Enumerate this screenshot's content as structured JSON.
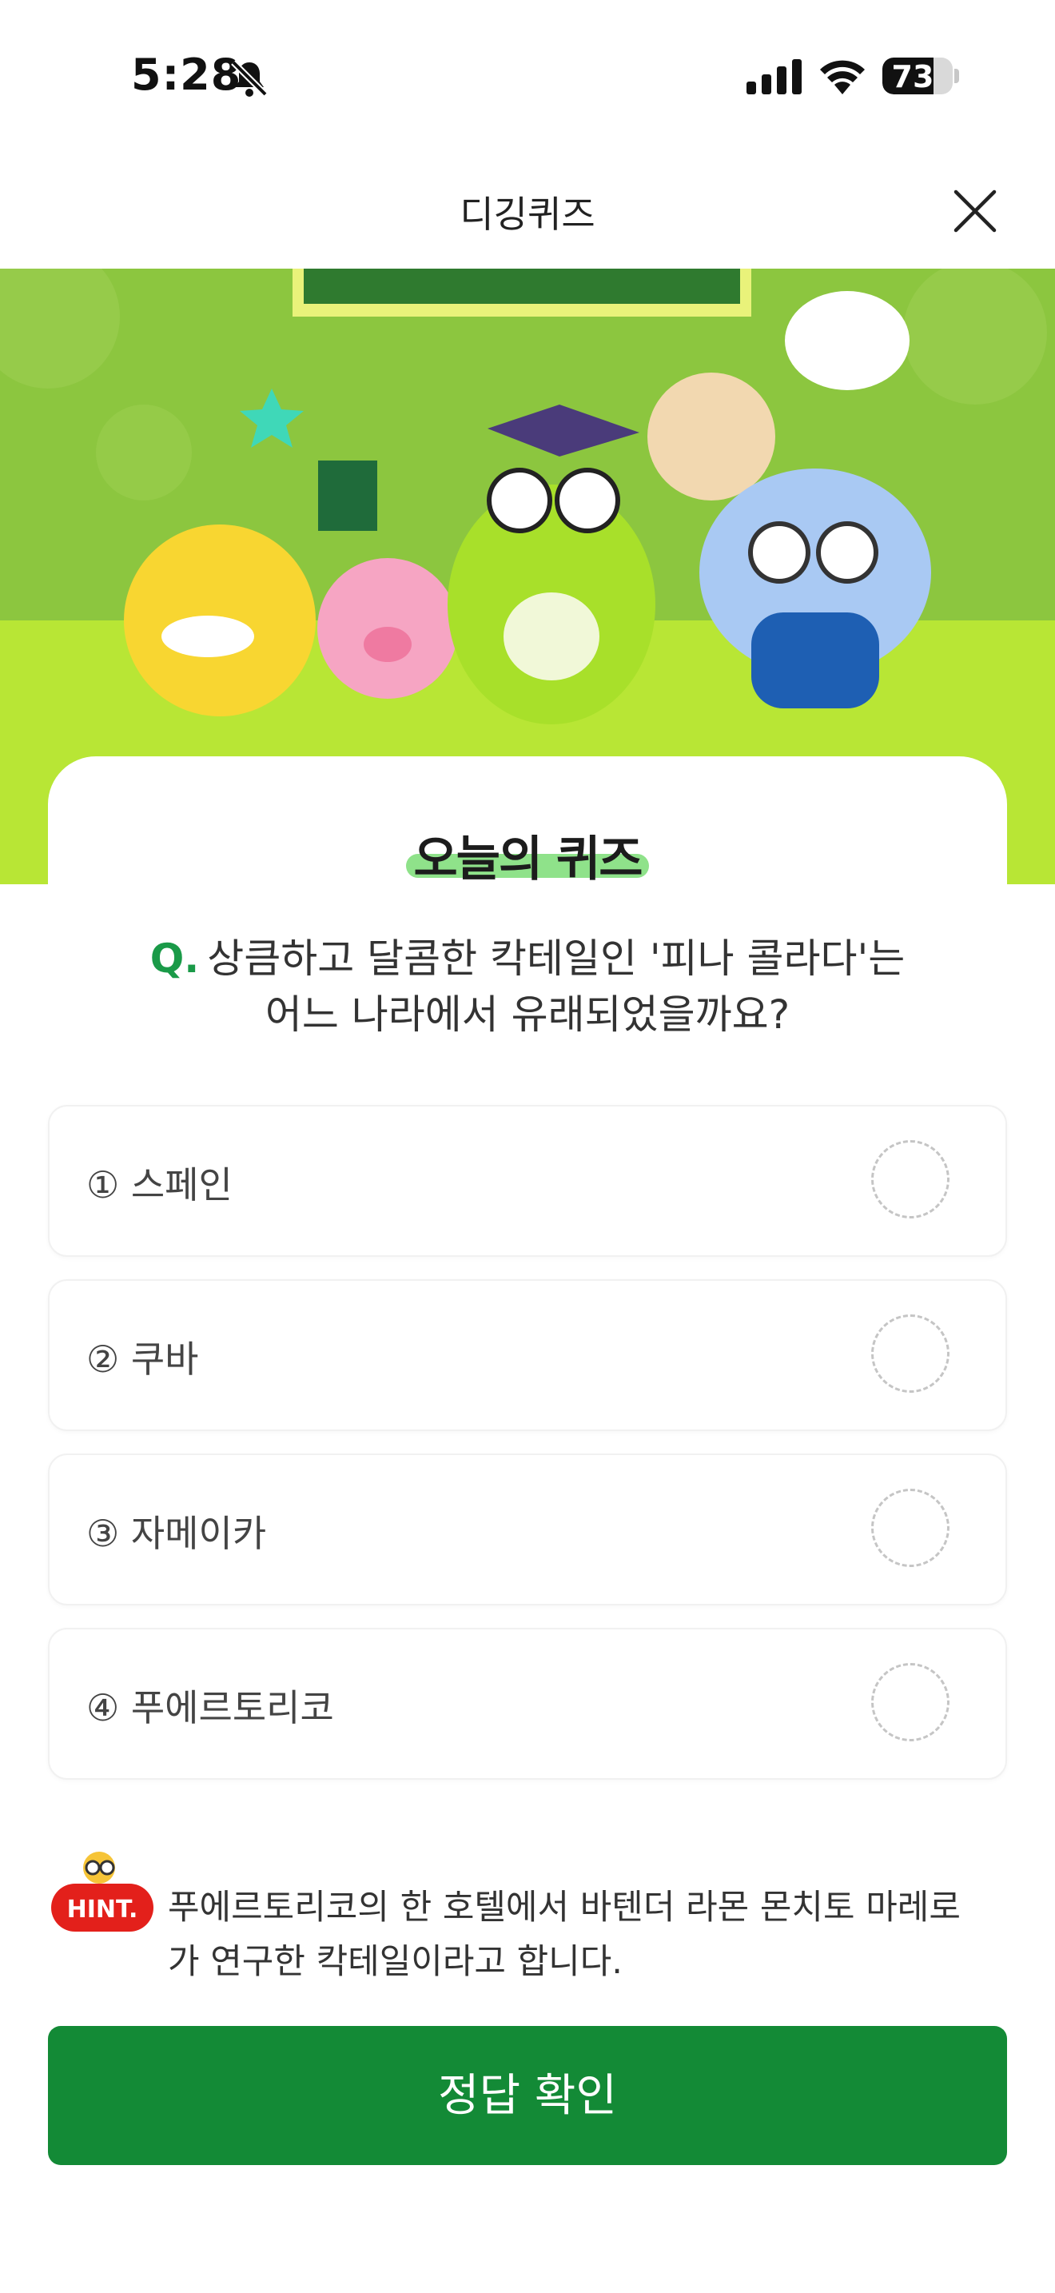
{
  "status_bar": {
    "time": "5:28",
    "battery": "73",
    "battery_level": 0.73
  },
  "header": {
    "title": "디깅퀴즈"
  },
  "quiz": {
    "title": "오늘의 퀴즈",
    "question_prefix": "Q.",
    "question_line1": "상큼하고 달콤한 칵테일인 '피나 콜라다'는",
    "question_line2": "어느 나라에서 유래되었을까요?",
    "options": [
      {
        "label": "① 스페인"
      },
      {
        "label": "② 쿠바"
      },
      {
        "label": "③ 자메이카"
      },
      {
        "label": "④ 푸에르토리코"
      }
    ],
    "hint_badge": "HINT.",
    "hint_line1": "푸에르토리코의 한 호텔에서 바텐더 라몬 몬치토 마레로",
    "hint_line2": "가 연구한 칵테일이라고 합니다.",
    "confirm_label": "정답 확인"
  },
  "colors": {
    "accent_green": "#138a36",
    "question_mark": "#1a9a48",
    "banner_bg": "#b8e635"
  },
  "icons": [
    "bell-slash-icon",
    "signal-icon",
    "wifi-icon",
    "battery-icon",
    "close-icon",
    "hint-icon"
  ]
}
